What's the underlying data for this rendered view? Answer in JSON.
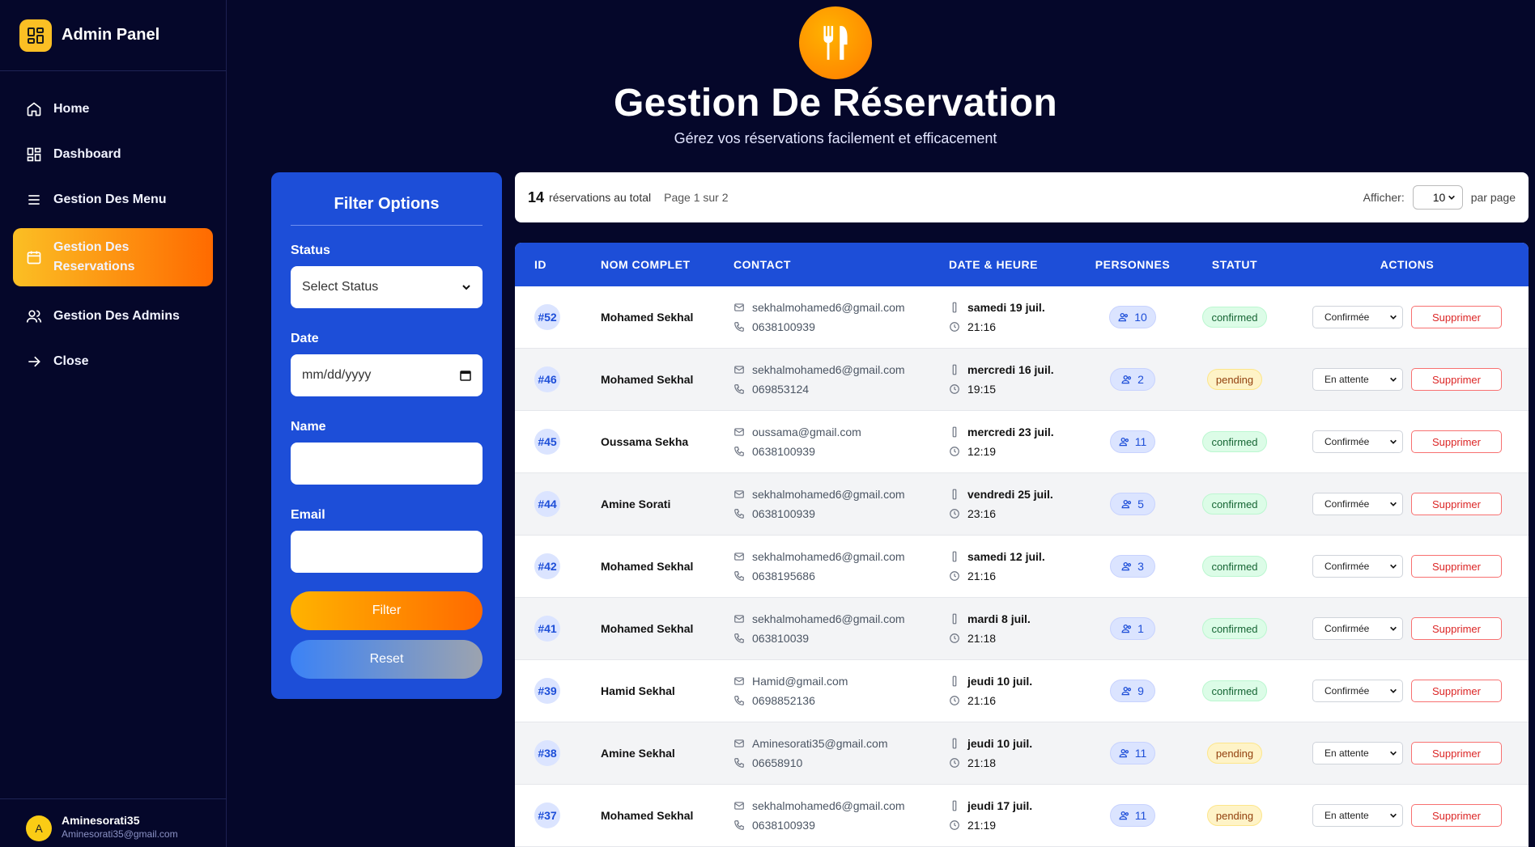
{
  "sidebar": {
    "title": "Admin Panel",
    "items": [
      {
        "label": "Home",
        "icon": "home-icon"
      },
      {
        "label": "Dashboard",
        "icon": "dashboard-icon"
      },
      {
        "label": "Gestion Des Menu",
        "icon": "menu-icon"
      },
      {
        "label": "Gestion Des Reservations",
        "icon": "calendar-icon",
        "active": true
      },
      {
        "label": "Gestion Des Admins",
        "icon": "users-icon"
      },
      {
        "label": "Close",
        "icon": "arrow-right-icon"
      }
    ],
    "user": {
      "initial": "A",
      "name": "Aminesorati35",
      "email": "Aminesorati35@gmail.com"
    }
  },
  "header": {
    "title": "Gestion De Réservation",
    "subtitle": "Gérez vos réservations facilement et efficacement"
  },
  "filter": {
    "title": "Filter Options",
    "status_label": "Status",
    "status_value": "Select Status",
    "date_label": "Date",
    "date_placeholder": "mm/dd/yyyy",
    "name_label": "Name",
    "email_label": "Email",
    "filter_button": "Filter",
    "reset_button": "Reset"
  },
  "summary": {
    "count": "14",
    "count_text": "réservations au total",
    "page_text": "Page 1 sur 2",
    "show_label": "Afficher:",
    "per_page_value": "10",
    "per_page_label": "par page"
  },
  "table": {
    "headers": [
      "ID",
      "NOM COMPLET",
      "CONTACT",
      "DATE & HEURE",
      "PERSONNES",
      "STATUT",
      "ACTIONS"
    ],
    "delete_label": "Supprimer",
    "rows": [
      {
        "id": "#52",
        "name": "Mohamed Sekhal",
        "email": "sekhalmohamed6@gmail.com",
        "phone": "0638100939",
        "date": "samedi 19 juil.",
        "time": "21:16",
        "persons": "10",
        "status": "confirmed",
        "action": "Confirmée"
      },
      {
        "id": "#46",
        "name": "Mohamed Sekhal",
        "email": "sekhalmohamed6@gmail.com",
        "phone": "069853124",
        "date": "mercredi 16 juil.",
        "time": "19:15",
        "persons": "2",
        "status": "pending",
        "action": "En attente"
      },
      {
        "id": "#45",
        "name": "Oussama Sekha",
        "email": "oussama@gmail.com",
        "phone": "0638100939",
        "date": "mercredi 23 juil.",
        "time": "12:19",
        "persons": "11",
        "status": "confirmed",
        "action": "Confirmée"
      },
      {
        "id": "#44",
        "name": "Amine Sorati",
        "email": "sekhalmohamed6@gmail.com",
        "phone": "0638100939",
        "date": "vendredi 25 juil.",
        "time": "23:16",
        "persons": "5",
        "status": "confirmed",
        "action": "Confirmée"
      },
      {
        "id": "#42",
        "name": "Mohamed Sekhal",
        "email": "sekhalmohamed6@gmail.com",
        "phone": "0638195686",
        "date": "samedi 12 juil.",
        "time": "21:16",
        "persons": "3",
        "status": "confirmed",
        "action": "Confirmée"
      },
      {
        "id": "#41",
        "name": "Mohamed Sekhal",
        "email": "sekhalmohamed6@gmail.com",
        "phone": "063810039",
        "date": "mardi 8 juil.",
        "time": "21:18",
        "persons": "1",
        "status": "confirmed",
        "action": "Confirmée"
      },
      {
        "id": "#39",
        "name": "Hamid Sekhal",
        "email": "Hamid@gmail.com",
        "phone": "0698852136",
        "date": "jeudi 10 juil.",
        "time": "21:16",
        "persons": "9",
        "status": "confirmed",
        "action": "Confirmée"
      },
      {
        "id": "#38",
        "name": "Amine Sekhal",
        "email": "Aminesorati35@gmail.com",
        "phone": "06658910",
        "date": "jeudi 10 juil.",
        "time": "21:18",
        "persons": "11",
        "status": "pending",
        "action": "En attente"
      },
      {
        "id": "#37",
        "name": "Mohamed Sekhal",
        "email": "sekhalmohamed6@gmail.com",
        "phone": "0638100939",
        "date": "jeudi 17 juil.",
        "time": "21:19",
        "persons": "11",
        "status": "pending",
        "action": "En attente"
      }
    ]
  },
  "colors": {
    "primary": "#1d4ed8",
    "accent": "#ff6a00",
    "background": "#05072a"
  }
}
